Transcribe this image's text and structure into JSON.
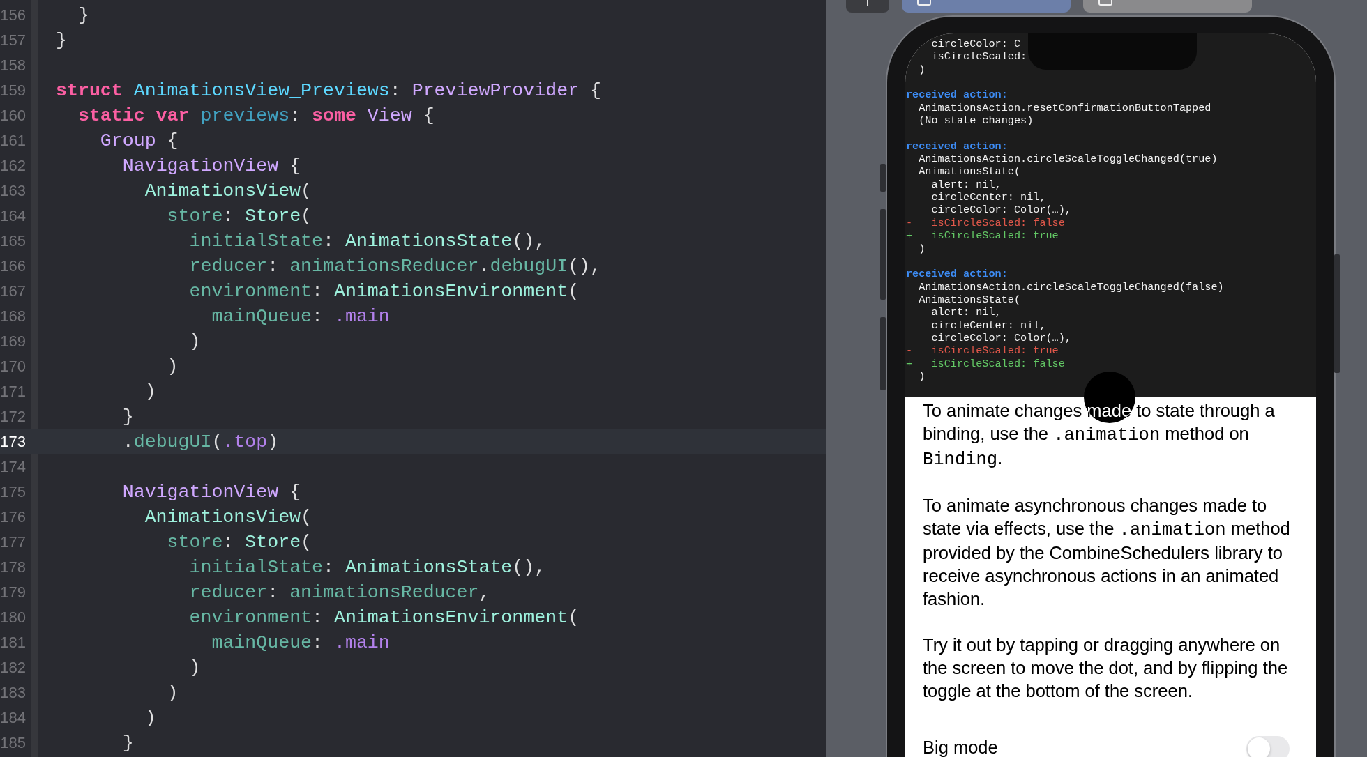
{
  "editor": {
    "lines": [
      {
        "number": "156",
        "current": false,
        "tokens": [
          {
            "text": "  }",
            "kind": "plain"
          }
        ]
      },
      {
        "number": "157",
        "current": false,
        "tokens": [
          {
            "text": "}",
            "kind": "plain"
          }
        ]
      },
      {
        "number": "158",
        "current": false
      },
      {
        "number": "159",
        "current": false,
        "tokens": [
          {
            "text": "struct",
            "kind": "keyword"
          },
          {
            "text": " AnimationsView_Previews",
            "kind": "declaration"
          },
          {
            "text": ": ",
            "kind": "plain"
          },
          {
            "text": "PreviewProvider",
            "kind": "system_type"
          },
          {
            "text": " {",
            "kind": "plain"
          }
        ]
      },
      {
        "number": "160",
        "current": false,
        "tokens": [
          {
            "text": "  static var",
            "kind": "keyword"
          },
          {
            "text": " previews",
            "kind": "variable"
          },
          {
            "text": ": ",
            "kind": "plain"
          },
          {
            "text": "some",
            "kind": "keyword"
          },
          {
            "text": " View",
            "kind": "system_type"
          },
          {
            "text": " {",
            "kind": "plain"
          }
        ]
      },
      {
        "number": "161",
        "current": false,
        "tokens": [
          {
            "text": "    Group",
            "kind": "system_type"
          },
          {
            "text": " {",
            "kind": "plain"
          }
        ]
      },
      {
        "number": "162",
        "current": false,
        "tokens": [
          {
            "text": "      NavigationView",
            "kind": "system_type"
          },
          {
            "text": " {",
            "kind": "plain"
          }
        ]
      },
      {
        "number": "163",
        "current": false,
        "tokens": [
          {
            "text": "        AnimationsView",
            "kind": "project_type"
          },
          {
            "text": "(",
            "kind": "plain"
          }
        ]
      },
      {
        "number": "164",
        "current": false,
        "tokens": [
          {
            "text": "          store",
            "kind": "project_member"
          },
          {
            "text": ": ",
            "kind": "plain"
          },
          {
            "text": "Store",
            "kind": "project_type"
          },
          {
            "text": "(",
            "kind": "plain"
          }
        ]
      },
      {
        "number": "165",
        "current": false,
        "tokens": [
          {
            "text": "            initialState",
            "kind": "project_member"
          },
          {
            "text": ": ",
            "kind": "plain"
          },
          {
            "text": "AnimationsState",
            "kind": "project_type"
          },
          {
            "text": "(),",
            "kind": "plain"
          }
        ]
      },
      {
        "number": "166",
        "current": false,
        "tokens": [
          {
            "text": "            reducer",
            "kind": "project_member"
          },
          {
            "text": ": ",
            "kind": "plain"
          },
          {
            "text": "animationsReducer",
            "kind": "project_member"
          },
          {
            "text": ".",
            "kind": "plain"
          },
          {
            "text": "debugUI",
            "kind": "project_member"
          },
          {
            "text": "(),",
            "kind": "plain"
          }
        ]
      },
      {
        "number": "167",
        "current": false,
        "tokens": [
          {
            "text": "            environment",
            "kind": "project_member"
          },
          {
            "text": ": ",
            "kind": "plain"
          },
          {
            "text": "AnimationsEnvironment",
            "kind": "project_type"
          },
          {
            "text": "(",
            "kind": "plain"
          }
        ]
      },
      {
        "number": "168",
        "current": false,
        "tokens": [
          {
            "text": "              mainQueue",
            "kind": "project_member"
          },
          {
            "text": ": ",
            "kind": "plain"
          },
          {
            "text": ".main",
            "kind": "system_member"
          }
        ]
      },
      {
        "number": "169",
        "current": false,
        "tokens": [
          {
            "text": "            )",
            "kind": "plain"
          }
        ]
      },
      {
        "number": "170",
        "current": false,
        "tokens": [
          {
            "text": "          )",
            "kind": "plain"
          }
        ]
      },
      {
        "number": "171",
        "current": false,
        "tokens": [
          {
            "text": "        )",
            "kind": "plain"
          }
        ]
      },
      {
        "number": "172",
        "current": false,
        "tokens": [
          {
            "text": "      }",
            "kind": "plain"
          }
        ]
      },
      {
        "number": "173",
        "current": true,
        "tokens": [
          {
            "text": "      .",
            "kind": "plain"
          },
          {
            "text": "debugUI",
            "kind": "project_member"
          },
          {
            "text": "(",
            "kind": "plain"
          },
          {
            "text": ".top",
            "kind": "system_member"
          },
          {
            "text": ")",
            "kind": "plain"
          }
        ]
      },
      {
        "number": "174",
        "current": false
      },
      {
        "number": "175",
        "current": false,
        "tokens": [
          {
            "text": "      NavigationView",
            "kind": "system_type"
          },
          {
            "text": " {",
            "kind": "plain"
          }
        ]
      },
      {
        "number": "176",
        "current": false,
        "tokens": [
          {
            "text": "        AnimationsView",
            "kind": "project_type"
          },
          {
            "text": "(",
            "kind": "plain"
          }
        ]
      },
      {
        "number": "177",
        "current": false,
        "tokens": [
          {
            "text": "          store",
            "kind": "project_member"
          },
          {
            "text": ": ",
            "kind": "plain"
          },
          {
            "text": "Store",
            "kind": "project_type"
          },
          {
            "text": "(",
            "kind": "plain"
          }
        ]
      },
      {
        "number": "178",
        "current": false,
        "tokens": [
          {
            "text": "            initialState",
            "kind": "project_member"
          },
          {
            "text": ": ",
            "kind": "plain"
          },
          {
            "text": "AnimationsState",
            "kind": "project_type"
          },
          {
            "text": "(),",
            "kind": "plain"
          }
        ]
      },
      {
        "number": "179",
        "current": false,
        "tokens": [
          {
            "text": "            reducer",
            "kind": "project_member"
          },
          {
            "text": ": ",
            "kind": "plain"
          },
          {
            "text": "animationsReducer",
            "kind": "project_member"
          },
          {
            "text": ",",
            "kind": "plain"
          }
        ]
      },
      {
        "number": "180",
        "current": false,
        "tokens": [
          {
            "text": "            environment",
            "kind": "project_member"
          },
          {
            "text": ": ",
            "kind": "plain"
          },
          {
            "text": "AnimationsEnvironment",
            "kind": "project_type"
          },
          {
            "text": "(",
            "kind": "plain"
          }
        ]
      },
      {
        "number": "181",
        "current": false,
        "tokens": [
          {
            "text": "              mainQueue",
            "kind": "project_member"
          },
          {
            "text": ": ",
            "kind": "plain"
          },
          {
            "text": ".main",
            "kind": "system_member"
          }
        ]
      },
      {
        "number": "182",
        "current": false,
        "tokens": [
          {
            "text": "            )",
            "kind": "plain"
          }
        ]
      },
      {
        "number": "183",
        "current": false,
        "tokens": [
          {
            "text": "          )",
            "kind": "plain"
          }
        ]
      },
      {
        "number": "184",
        "current": false,
        "tokens": [
          {
            "text": "        )",
            "kind": "plain"
          }
        ]
      },
      {
        "number": "185",
        "current": false,
        "tokens": [
          {
            "text": "      }",
            "kind": "plain"
          }
        ]
      }
    ]
  },
  "preview": {
    "tabs": [
      {
        "selected": true
      },
      {
        "selected": false
      }
    ],
    "debug_log": [
      {
        "kind": "plain",
        "text": "    circleColor: C"
      },
      {
        "kind": "plain",
        "text": "    isCircleScaled:"
      },
      {
        "kind": "plain",
        "text": "  )"
      },
      {
        "kind": "gap"
      },
      {
        "kind": "header",
        "text": "received action:"
      },
      {
        "kind": "plain",
        "text": "  AnimationsAction.resetConfirmationButtonTapped"
      },
      {
        "kind": "plain",
        "text": "  (No state changes)"
      },
      {
        "kind": "gap"
      },
      {
        "kind": "header",
        "text": "received action:"
      },
      {
        "kind": "plain",
        "text": "  AnimationsAction.circleScaleToggleChanged(true)"
      },
      {
        "kind": "plain",
        "text": "  AnimationsState("
      },
      {
        "kind": "plain",
        "text": "    alert: nil,"
      },
      {
        "kind": "plain",
        "text": "    circleCenter: nil,"
      },
      {
        "kind": "plain",
        "text": "    circleColor: Color(…),"
      },
      {
        "kind": "removed",
        "text": "-   isCircleScaled: false"
      },
      {
        "kind": "added",
        "text": "+   isCircleScaled: true"
      },
      {
        "kind": "plain",
        "text": "  )"
      },
      {
        "kind": "gap"
      },
      {
        "kind": "header",
        "text": "received action:"
      },
      {
        "kind": "plain",
        "text": "  AnimationsAction.circleScaleToggleChanged(false)"
      },
      {
        "kind": "plain",
        "text": "  AnimationsState("
      },
      {
        "kind": "plain",
        "text": "    alert: nil,"
      },
      {
        "kind": "plain",
        "text": "    circleCenter: nil,"
      },
      {
        "kind": "plain",
        "text": "    circleColor: Color(…),"
      },
      {
        "kind": "removed",
        "text": "-   isCircleScaled: true"
      },
      {
        "kind": "added",
        "text": "+   isCircleScaled: false"
      },
      {
        "kind": "plain",
        "text": "  )"
      }
    ],
    "content": {
      "paragraphs": [
        [
          {
            "text": "To animate changes made to state through a binding, use the ",
            "kind": "prose"
          },
          {
            "text": ".animation",
            "kind": "code"
          },
          {
            "text": " method on ",
            "kind": "prose"
          },
          {
            "text": "Binding",
            "kind": "code"
          },
          {
            "text": ".",
            "kind": "prose"
          }
        ],
        [
          {
            "text": "To animate asynchronous changes made to state via effects, use the ",
            "kind": "prose"
          },
          {
            "text": ".animation",
            "kind": "code"
          },
          {
            "text": " method provided by the CombineSchedulers library to receive asynchronous actions in an animated fashion.",
            "kind": "prose"
          }
        ],
        [
          {
            "text": "Try it out by tapping or dragging anywhere on the screen to move the dot, and by flipping the toggle at the bottom of the screen.",
            "kind": "prose"
          }
        ]
      ],
      "toggle": {
        "label": "Big mode",
        "on": false
      }
    }
  }
}
